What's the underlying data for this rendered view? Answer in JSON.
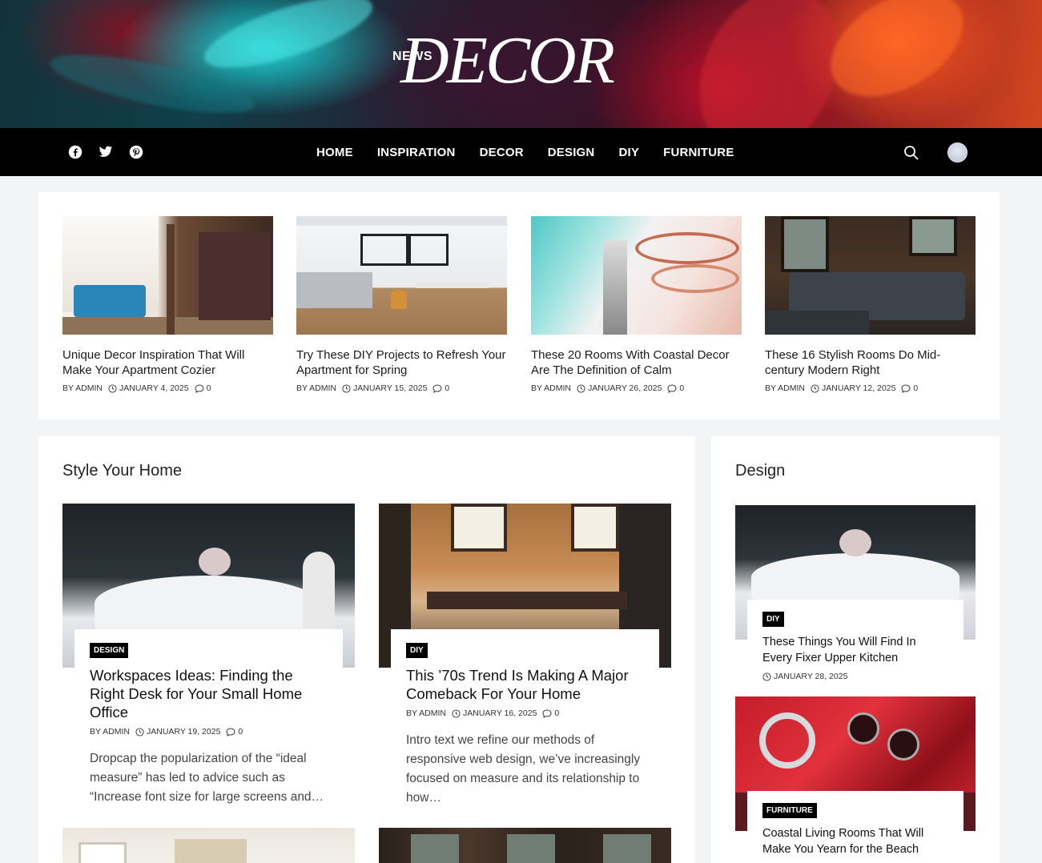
{
  "brand": {
    "news": "NEWS",
    "decor": "DECOR"
  },
  "social": [
    {
      "icon": "facebook-icon"
    },
    {
      "icon": "twitter-icon"
    },
    {
      "icon": "pinterest-icon"
    }
  ],
  "nav": {
    "items": [
      "HOME",
      "INSPIRATION",
      "DECOR",
      "DESIGN",
      "DIY",
      "FURNITURE"
    ],
    "search_icon": "search-icon",
    "avatar": "avatar"
  },
  "featured": [
    {
      "title": "Unique Decor Inspiration That Will Make Your Apartment Cozier",
      "author": "BY ADMIN",
      "date": "JANUARY 4, 2025",
      "comments": "0"
    },
    {
      "title": "Try These DIY Projects to Refresh Your Apartment for Spring",
      "author": "BY ADMIN",
      "date": "JANUARY 15, 2025",
      "comments": "0"
    },
    {
      "title": "These 20 Rooms With Coastal Decor Are The Definition of Calm",
      "author": "BY ADMIN",
      "date": "JANUARY 26, 2025",
      "comments": "0"
    },
    {
      "title": "These 16 Stylish Rooms Do Mid-century Modern Right",
      "author": "BY ADMIN",
      "date": "JANUARY 12, 2025",
      "comments": "0"
    }
  ],
  "style_section": {
    "title": "Style Your Home",
    "posts": [
      {
        "category": "DESIGN",
        "title": "Workspaces Ideas: Finding the Right Desk for Your Small Home Office",
        "author": "BY ADMIN",
        "date": "JANUARY 19, 2025",
        "comments": "0",
        "excerpt": "Dropcap the popularization of the “ideal measure” has led to advice such as “Increase font size for large screens and…"
      },
      {
        "category": "DIY",
        "title": "This ’70s Trend Is Making A Major Comeback For Your Home",
        "author": "BY ADMIN",
        "date": "JANUARY 16, 2025",
        "comments": "0",
        "excerpt": "Intro text we refine our methods of responsive web design, we’ve increasingly focused on measure and its relationship to how…"
      }
    ]
  },
  "design_section": {
    "title": "Design",
    "posts": [
      {
        "category": "DIY",
        "title": "These Things You Will Find In Every Fixer Upper Kitchen",
        "date": "JANUARY 28, 2025"
      },
      {
        "category": "FURNITURE",
        "title": "Coastal Living Rooms That Will Make You Yearn for the Beach",
        "date": ""
      }
    ]
  },
  "colors": {
    "nav_bg": "#000000",
    "page_bg": "#f3f4f6",
    "card_bg": "#ffffff",
    "badge_bg": "#000000"
  }
}
